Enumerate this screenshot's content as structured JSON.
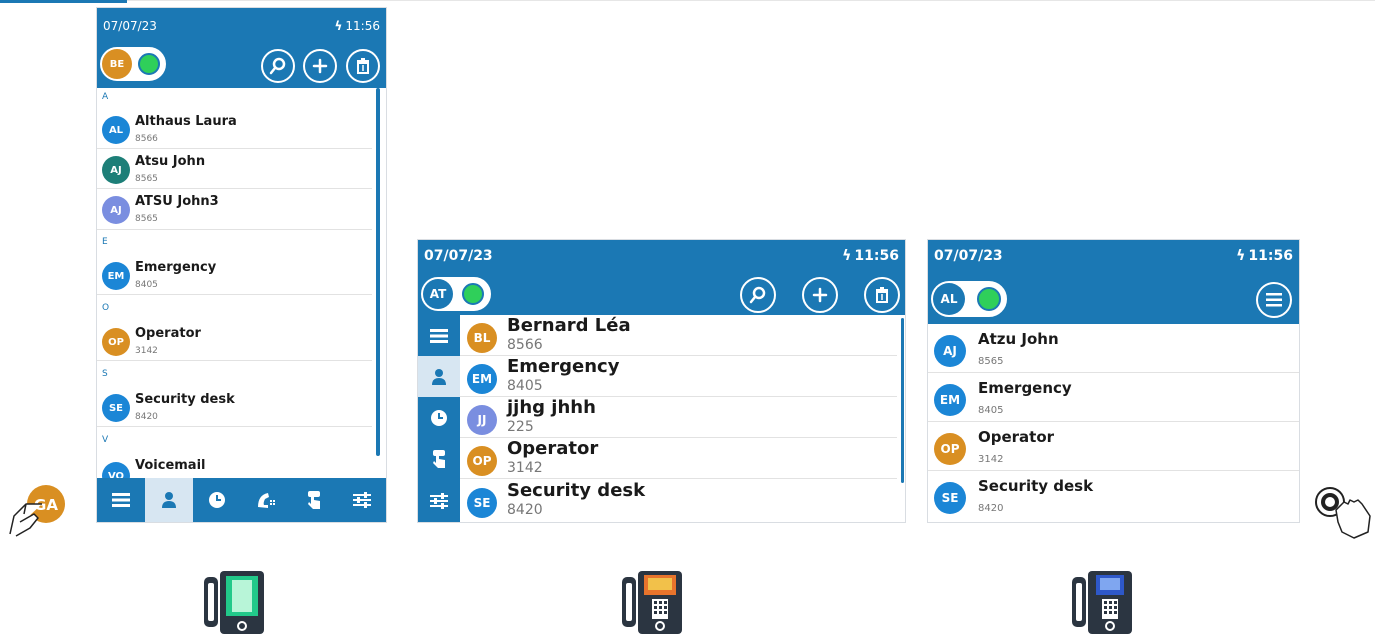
{
  "colors": {
    "primary": "#1b78b4",
    "presence": "#2fcf5a",
    "orange": "#d98f22",
    "teal": "#1d7f78",
    "purple": "#7a8ee0",
    "blue": "#1b86d6",
    "gray_text": "#777777"
  },
  "icons": {
    "left_hand": "touch-hand-icon",
    "right_hand": "knob-touch-hand-icon"
  },
  "left_badge": {
    "initials": "GA",
    "color": "#d98f22"
  },
  "screen1": {
    "date": "07/07/23",
    "time": "11:56",
    "user_initials": "BE",
    "user_color": "#d98f22",
    "sections": [
      "A",
      "E",
      "O",
      "S",
      "V"
    ],
    "contacts": [
      {
        "name": "Althaus Laura",
        "number": "8566",
        "initials": "AL",
        "color": "#1b86d6"
      },
      {
        "name": "Atsu John",
        "number": "8565",
        "initials": "AJ",
        "color": "#1d7f78"
      },
      {
        "name": "ATSU John3",
        "number": "8565",
        "initials": "AJ",
        "color": "#7a8ee0"
      },
      {
        "name": "Emergency",
        "number": "8405",
        "initials": "EM",
        "color": "#1b86d6"
      },
      {
        "name": "Operator",
        "number": "3142",
        "initials": "OP",
        "color": "#d98f22"
      },
      {
        "name": "Security desk",
        "number": "8420",
        "initials": "SE",
        "color": "#1b86d6"
      },
      {
        "name": "Voicemail",
        "number": "",
        "initials": "VO",
        "color": "#1b86d6"
      }
    ],
    "nav_icons": [
      "menu-icon",
      "contacts-icon",
      "history-icon",
      "call-icon",
      "touch-icon",
      "settings-icon"
    ]
  },
  "screen2": {
    "date": "07/07/23",
    "time": "11:56",
    "user_initials": "AT",
    "user_color": "#1b78b4",
    "contacts": [
      {
        "name": "Bernard Léa",
        "number": "8566",
        "initials": "BL",
        "color": "#d98f22"
      },
      {
        "name": "Emergency",
        "number": "8405",
        "initials": "EM",
        "color": "#1b86d6"
      },
      {
        "name": "jjhg jhhh",
        "number": "225",
        "initials": "JJ",
        "color": "#7a8ee0"
      },
      {
        "name": "Operator",
        "number": "3142",
        "initials": "OP",
        "color": "#d98f22"
      },
      {
        "name": "Security desk",
        "number": "8420",
        "initials": "SE",
        "color": "#1b86d6"
      }
    ],
    "side_icons": [
      "menu-icon",
      "contacts-icon",
      "history-icon",
      "touch-icon",
      "settings-icon"
    ]
  },
  "screen3": {
    "date": "07/07/23",
    "time": "11:56",
    "user_initials": "AL",
    "user_color": "#1b78b4",
    "contacts": [
      {
        "name": "Atzu John",
        "number": "8565",
        "initials": "AJ",
        "color": "#1b86d6"
      },
      {
        "name": "Emergency",
        "number": "8405",
        "initials": "EM",
        "color": "#1b86d6"
      },
      {
        "name": "Operator",
        "number": "3142",
        "initials": "OP",
        "color": "#d98f22"
      },
      {
        "name": "Security desk",
        "number": "8420",
        "initials": "SE",
        "color": "#1b86d6"
      }
    ]
  },
  "phones": [
    {
      "model": "desk-phone-tall-screen-icon",
      "screen_color": "#22c98a"
    },
    {
      "model": "desk-phone-color-screen-icon",
      "screen_color": "#e8742c"
    },
    {
      "model": "desk-phone-small-screen-icon",
      "screen_color": "#2e58c9"
    }
  ]
}
